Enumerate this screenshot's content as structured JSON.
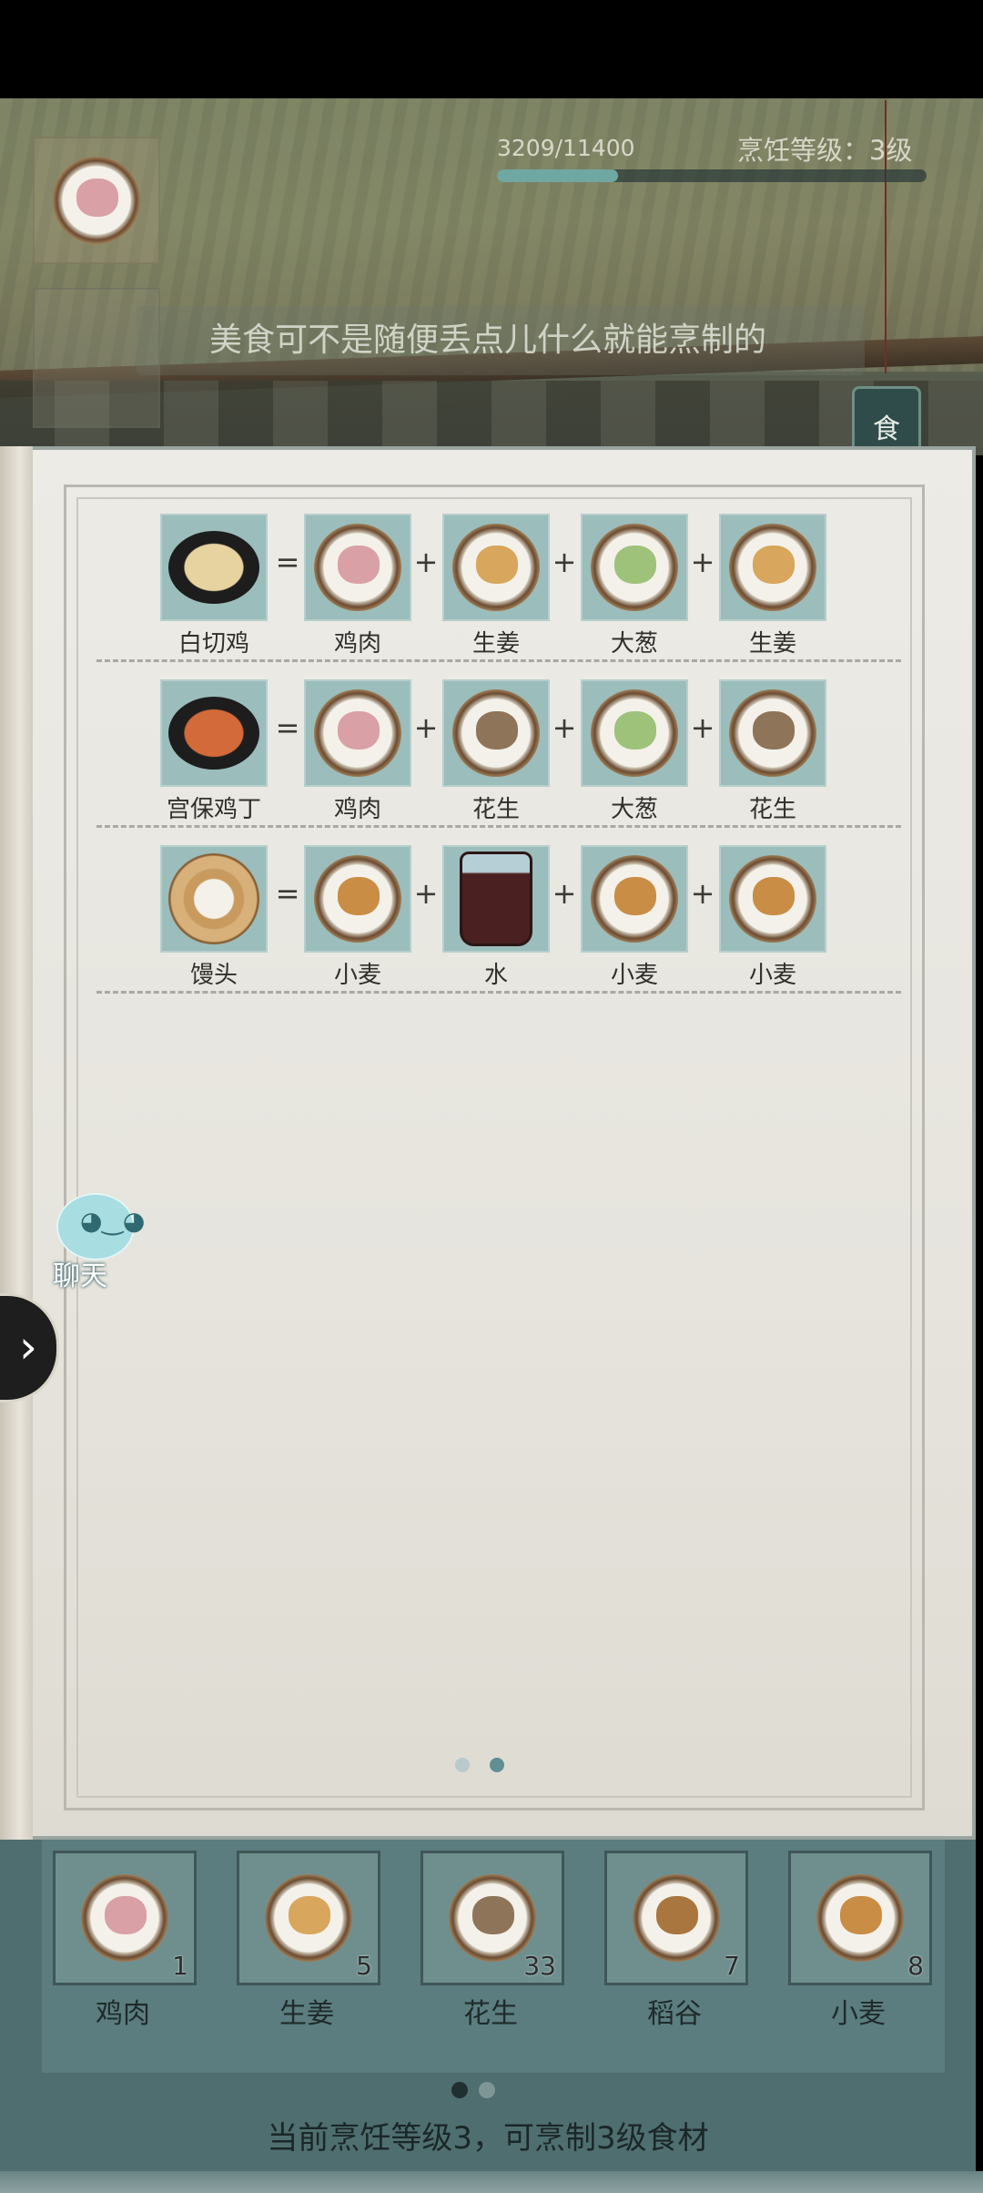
{
  "hud": {
    "progress_text": "3209/11400",
    "progress": {
      "current": 3209,
      "max": 11400
    },
    "cooking_level_text": "烹饪等级：3级",
    "tip_text": "美食可不是随便丢点儿什么就能烹制的",
    "side_tab_label": "食"
  },
  "recipes": [
    {
      "result": {
        "name": "白切鸡",
        "icon": "white-cut-chicken-icon"
      },
      "ingredients": [
        {
          "name": "鸡肉",
          "icon": "chicken-meat-icon"
        },
        {
          "name": "生姜",
          "icon": "ginger-icon"
        },
        {
          "name": "大葱",
          "icon": "scallion-icon"
        },
        {
          "name": "生姜",
          "icon": "ginger-icon"
        }
      ]
    },
    {
      "result": {
        "name": "宫保鸡丁",
        "icon": "kung-pao-chicken-icon"
      },
      "ingredients": [
        {
          "name": "鸡肉",
          "icon": "chicken-meat-icon"
        },
        {
          "name": "花生",
          "icon": "peanut-icon"
        },
        {
          "name": "大葱",
          "icon": "scallion-icon"
        },
        {
          "name": "花生",
          "icon": "peanut-icon"
        }
      ]
    },
    {
      "result": {
        "name": "馒头",
        "icon": "steamed-bun-icon"
      },
      "ingredients": [
        {
          "name": "小麦",
          "icon": "wheat-icon"
        },
        {
          "name": "水",
          "icon": "water-bucket-icon"
        },
        {
          "name": "小麦",
          "icon": "wheat-icon"
        },
        {
          "name": "小麦",
          "icon": "wheat-icon"
        }
      ]
    }
  ],
  "operators": {
    "equals": "=",
    "plus": "+"
  },
  "book_pager": {
    "pages": 2,
    "active": 2
  },
  "chat": {
    "label": "聊天"
  },
  "expand_arrow": "›",
  "inventory": {
    "items": [
      {
        "name": "鸡肉",
        "count": "1",
        "icon": "chicken-meat-icon"
      },
      {
        "name": "生姜",
        "count": "5",
        "icon": "ginger-icon"
      },
      {
        "name": "花生",
        "count": "33",
        "icon": "peanut-icon"
      },
      {
        "name": "稻谷",
        "count": "7",
        "icon": "rice-grain-icon"
      },
      {
        "name": "小麦",
        "count": "8",
        "icon": "wheat-icon"
      }
    ],
    "pager": {
      "pages": 2,
      "active": 1
    },
    "footer_text": "当前烹饪等级3，可烹制3级食材"
  },
  "colors": {
    "chicken": "#d9a0a6",
    "ginger": "#d8a65c",
    "scallion": "#9fc27a",
    "peanut": "#8e7458",
    "wheat": "#c98d45",
    "rice": "#a8763e",
    "kungpao": "#d36a3a",
    "baiqie": "#e6d3a0"
  }
}
